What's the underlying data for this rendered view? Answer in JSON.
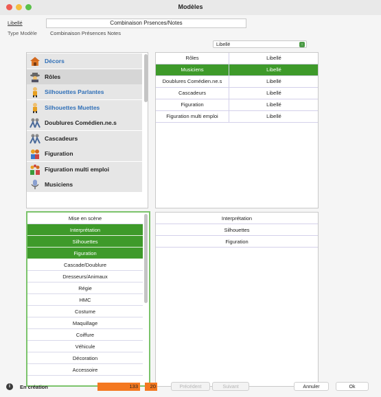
{
  "window": {
    "title": "Modèles"
  },
  "header": {
    "libelle_label": "Libellé",
    "libelle_value": "Combinaison Prsences/Notes",
    "type_label": "Type Modèle",
    "type_value": "Combinaison Présences Notes"
  },
  "popup": {
    "value": "Libellé"
  },
  "categories": [
    {
      "label": "Décors",
      "icon": "decors-icon",
      "color": "blue"
    },
    {
      "label": "Rôles",
      "icon": "roles-icon",
      "color": "dark"
    },
    {
      "label": "Silhouettes Parlantes",
      "icon": "silhouette-parlante-icon",
      "color": "blue"
    },
    {
      "label": "Silhouettes Muettes",
      "icon": "silhouette-muette-icon",
      "color": "blue"
    },
    {
      "label": "Doublures Comédien.ne.s",
      "icon": "doublures-icon",
      "color": "dark"
    },
    {
      "label": "Cascadeurs",
      "icon": "cascadeurs-icon",
      "color": "dark"
    },
    {
      "label": "Figuration",
      "icon": "figuration-icon",
      "color": "dark"
    },
    {
      "label": "Figuration multi emploi",
      "icon": "figuration-multi-icon",
      "color": "dark"
    },
    {
      "label": "Musiciens",
      "icon": "microphone-icon",
      "color": "dark"
    }
  ],
  "table": {
    "rows": [
      {
        "c1": "Rôles",
        "c2": "Libellé"
      },
      {
        "c1": "Musiciens",
        "c2": "Libellé"
      },
      {
        "c1": "Doublures Comédien.ne.s",
        "c2": "Libellé"
      },
      {
        "c1": "Cascadeurs",
        "c2": "Libellé"
      },
      {
        "c1": "Figuration",
        "c2": "Libellé"
      },
      {
        "c1": "Figuration multi emploi",
        "c2": "Libellé"
      }
    ],
    "selected_index": 1
  },
  "mise": {
    "items": [
      "Mise en scène",
      "Interprétation",
      "Silhouettes",
      "Figuration",
      "Cascade/Doublure",
      "Dresseurs/Animaux",
      "Régie",
      "HMC",
      "Costume",
      "Maquillage",
      "Coiffure",
      "Véhicule",
      "Décoration",
      "Accessoire"
    ],
    "selected": [
      1,
      2,
      3
    ]
  },
  "dest": {
    "items": [
      "Interprétation",
      "Silhouettes",
      "Figuration"
    ]
  },
  "footer": {
    "status": "En création",
    "count1": "133",
    "count2": "20",
    "prev": "Précédent",
    "next": "Suivant",
    "cancel": "Annuler",
    "ok": "Ok"
  },
  "colors": {
    "accent_green": "#3e9a2a",
    "link_blue": "#2f6fb7",
    "counter_orange": "#f47820"
  }
}
